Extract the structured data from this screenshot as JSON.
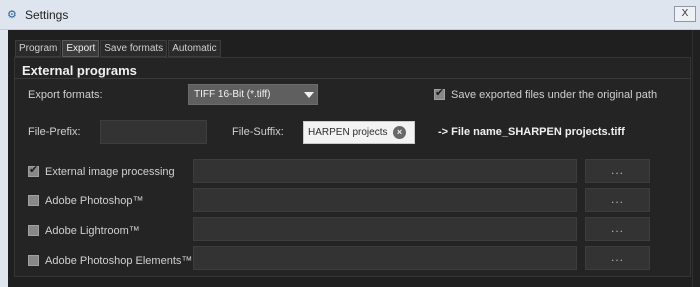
{
  "window": {
    "title": "Settings",
    "close_label": "X"
  },
  "tabs": [
    {
      "label": "Program",
      "active": false
    },
    {
      "label": "Export",
      "active": true
    },
    {
      "label": "Save formats",
      "active": false
    },
    {
      "label": "Automatic",
      "active": false
    }
  ],
  "section": {
    "title": "External programs"
  },
  "export_formats": {
    "label": "Export formats:",
    "value": "TIFF 16-Bit (*.tiff)"
  },
  "save_under_original": {
    "label": "Save exported files under the original path",
    "checked": true
  },
  "prefix": {
    "label": "File-Prefix:",
    "value": ""
  },
  "suffix": {
    "label": "File-Suffix:",
    "value": "HARPEN projects"
  },
  "preview": {
    "text": "-> File name_SHARPEN projects.tiff"
  },
  "programs": [
    {
      "label": "External image processing",
      "checked": true,
      "path": "",
      "browse_label": "..."
    },
    {
      "label": "Adobe Photoshop™",
      "checked": false,
      "path": "",
      "browse_label": "..."
    },
    {
      "label": "Adobe Lightroom™",
      "checked": false,
      "path": "",
      "browse_label": "..."
    },
    {
      "label": "Adobe Photoshop Elements™",
      "checked": false,
      "path": "",
      "browse_label": "..."
    }
  ],
  "colors": {
    "background": "#1f1f1f",
    "panel": "#242424",
    "titlebar": "#dfe5ee",
    "accent": "#f0f0f0"
  }
}
